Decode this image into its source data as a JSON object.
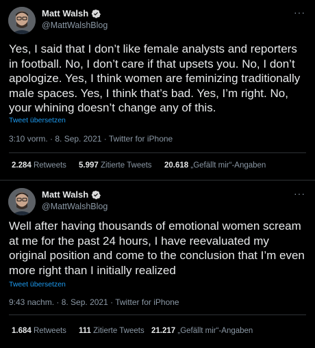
{
  "tweets": [
    {
      "name": "Matt Walsh",
      "handle": "@MattWalshBlog",
      "text": "Yes, I said that I don’t like female analysts and reporters in football. No, I don’t care if that upsets you. No, I don’t apologize. Yes, I think women are feminizing traditionally male spaces. Yes, I think that’s bad. Yes, I’m right. No, your whining doesn’t change any of this.",
      "translate": "Tweet übersetzen",
      "meta": "3:10 vorm. · 8. Sep. 2021 · Twitter for iPhone",
      "stats": {
        "retweets_count": "2.284",
        "retweets_label": "Retweets",
        "quotes_count": "5.997",
        "quotes_label": "Zitierte Tweets",
        "likes_count": "20.618",
        "likes_label": "„Gefällt mir“-Angaben"
      }
    },
    {
      "name": "Matt Walsh",
      "handle": "@MattWalshBlog",
      "text": "Well after having thousands of emotional women scream at me for the past 24 hours, I have reevaluated my original position and come to the conclusion that I’m even more right than I initially realized",
      "translate": "Tweet übersetzen",
      "meta": "9:43 nachm. · 8. Sep. 2021 · Twitter for iPhone",
      "stats": {
        "retweets_count": "1.684",
        "retweets_label": "Retweets",
        "quotes_count": "111",
        "quotes_label": "Zitierte Tweets",
        "likes_count": "21.217",
        "likes_label": "„Gefällt mir“-Angaben"
      }
    }
  ],
  "icons": {
    "verified": "verified-badge-icon",
    "more": "more-options-icon",
    "avatar": "profile-avatar"
  },
  "colors": {
    "background": "#000000",
    "link": "#1d9bf0",
    "secondary": "#8b98a5",
    "verified": "#1d9bf0"
  }
}
